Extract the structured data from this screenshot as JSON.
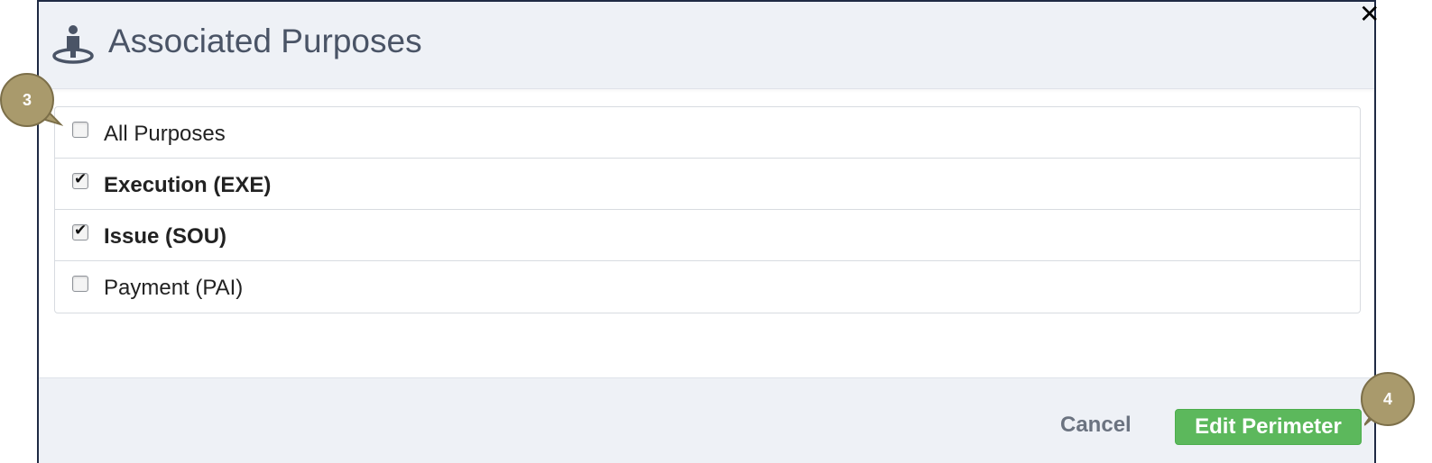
{
  "dialog": {
    "title": "Associated Purposes",
    "header_icon": "person-location-icon",
    "close_label": "✕"
  },
  "purposes": [
    {
      "label": "All Purposes",
      "checked": false,
      "bold": false
    },
    {
      "label": "Execution (EXE)",
      "checked": true,
      "bold": true
    },
    {
      "label": "Issue (SOU)",
      "checked": true,
      "bold": true
    },
    {
      "label": "Payment (PAI)",
      "checked": false,
      "bold": false
    }
  ],
  "footer": {
    "cancel_label": "Cancel",
    "submit_label": "Edit Perimeter"
  },
  "annotations": [
    {
      "number": "3"
    },
    {
      "number": "4"
    }
  ],
  "colors": {
    "header_bg": "#eef1f6",
    "primary": "#5cb85c",
    "badge": "#a99a6c",
    "title_text": "#4a5466"
  }
}
